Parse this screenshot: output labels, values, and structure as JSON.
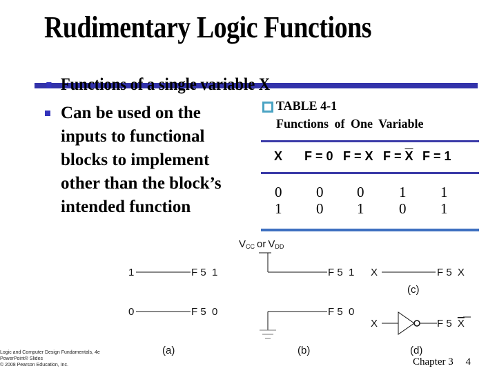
{
  "slide": {
    "title": "Rudimentary Logic Functions",
    "bullets": [
      {
        "lines": [
          "Functions of a single variable X"
        ]
      },
      {
        "lines": [
          "Can be used on the",
          "inputs to functional",
          "blocks to implement",
          "other than the block’s",
          "intended function"
        ]
      }
    ],
    "table": {
      "label": "TABLE 4-1",
      "caption": "Functions of  One  Variable",
      "headers": [
        "X",
        "F = 0",
        "F = X",
        "F = ",
        "X",
        "F = 1"
      ],
      "rows": [
        [
          "0",
          "0",
          "0",
          "1",
          "1"
        ],
        [
          "1",
          "0",
          "1",
          "0",
          "1"
        ]
      ]
    },
    "diagram": {
      "a": {
        "caption": "(a)",
        "in1": "1",
        "out1": "F 5  1",
        "in0": "0",
        "out0": "F 5  0"
      },
      "b": {
        "caption": "(b)",
        "supply": "V",
        "supply_sub1": "CC",
        "supply_or": "or",
        "supply_sub2": "DD",
        "out1": "F 5  1",
        "out0": "F 5  0"
      },
      "c": {
        "caption": "(c)",
        "in": "X",
        "out_prefix": "F 5 ",
        "out_var": "X"
      },
      "d": {
        "caption": "(d)",
        "in": "X",
        "out_prefix": "F 5 ",
        "out_var": "X"
      }
    },
    "footer": {
      "left": [
        "Logic and Computer Design Fundamentals, 4e",
        "PowerPoint® Slides",
        "© 2008 Pearson Education, Inc."
      ],
      "chapter": "Chapter 3",
      "page": "4"
    },
    "colors": {
      "accent": "#3333aa",
      "table_box": "#4aa3c3"
    }
  }
}
